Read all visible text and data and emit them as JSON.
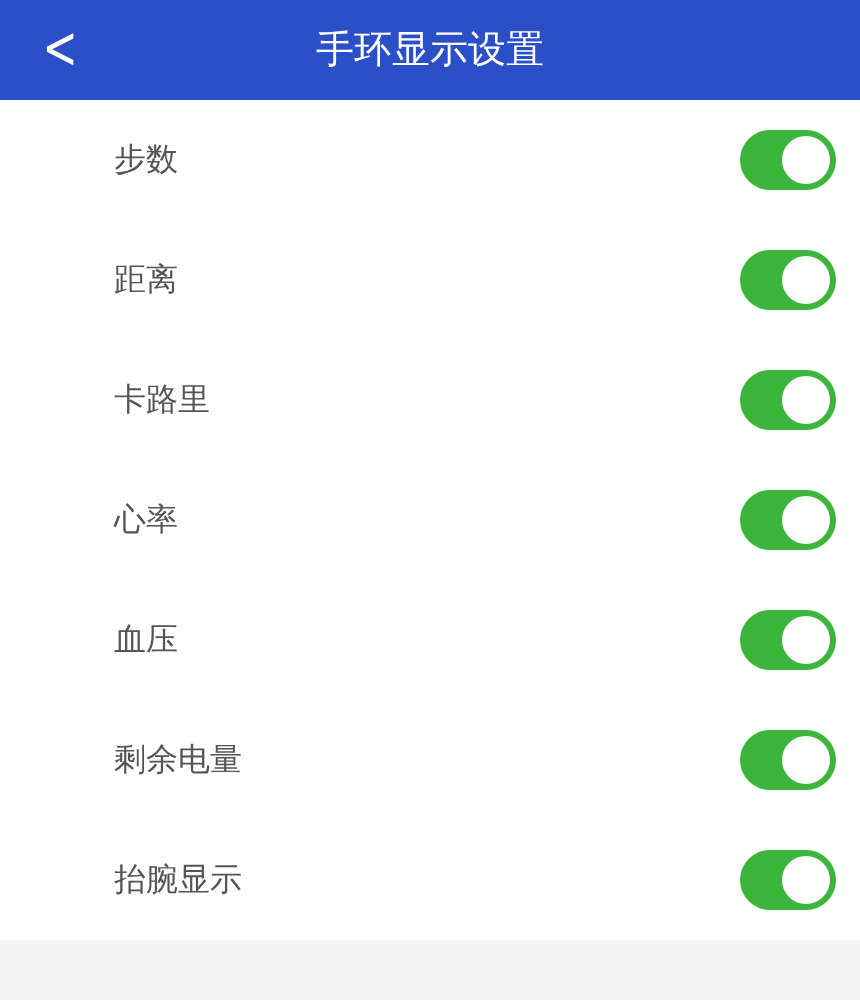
{
  "header": {
    "back": "<",
    "title": "手环显示设置"
  },
  "settings": [
    {
      "label": "步数",
      "on": true
    },
    {
      "label": "距离",
      "on": true
    },
    {
      "label": "卡路里",
      "on": true
    },
    {
      "label": "心率",
      "on": true
    },
    {
      "label": "血压",
      "on": true
    },
    {
      "label": "剩余电量",
      "on": true
    },
    {
      "label": "抬腕显示",
      "on": true
    }
  ]
}
